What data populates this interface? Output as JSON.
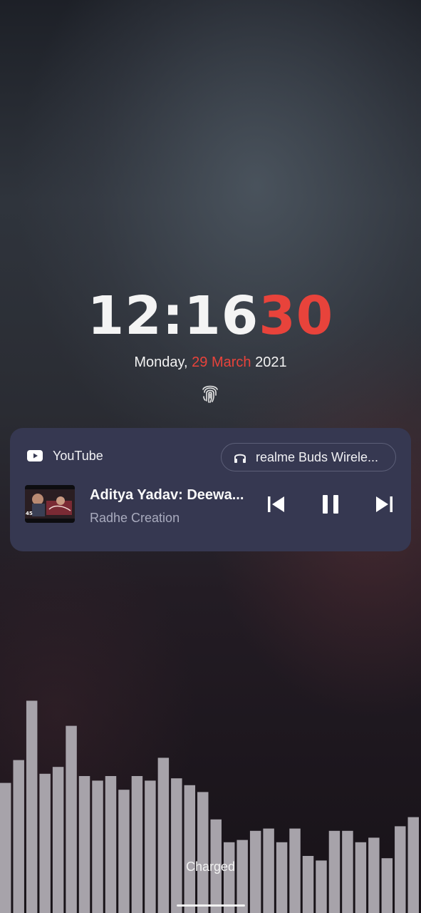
{
  "clock": {
    "hours_minutes": "12:16",
    "seconds": "30"
  },
  "date": {
    "weekday": "Monday,",
    "day_month": "29 March",
    "year": "2021"
  },
  "media": {
    "app_name": "YouTube",
    "output_device": "realme Buds Wirele...",
    "title": "Aditya Yadav: Deewa...",
    "artist": "Radhe Creation",
    "thumbnail_badge": "45",
    "controls": [
      "previous",
      "pause",
      "next"
    ]
  },
  "status": {
    "charge_text": "Charged"
  },
  "visualizer": {
    "levels": [
      0.57,
      0.67,
      0.93,
      0.61,
      0.64,
      0.82,
      0.6,
      0.58,
      0.6,
      0.54,
      0.6,
      0.58,
      0.68,
      0.59,
      0.56,
      0.53,
      0.41,
      0.31,
      0.32,
      0.36,
      0.37,
      0.31,
      0.37,
      0.25,
      0.23,
      0.36,
      0.36,
      0.31,
      0.33,
      0.24,
      0.38,
      0.42
    ]
  },
  "colors": {
    "accent": "#e8433b",
    "card_background": "#363851",
    "visualizer_bar": "#a7a3aa"
  }
}
